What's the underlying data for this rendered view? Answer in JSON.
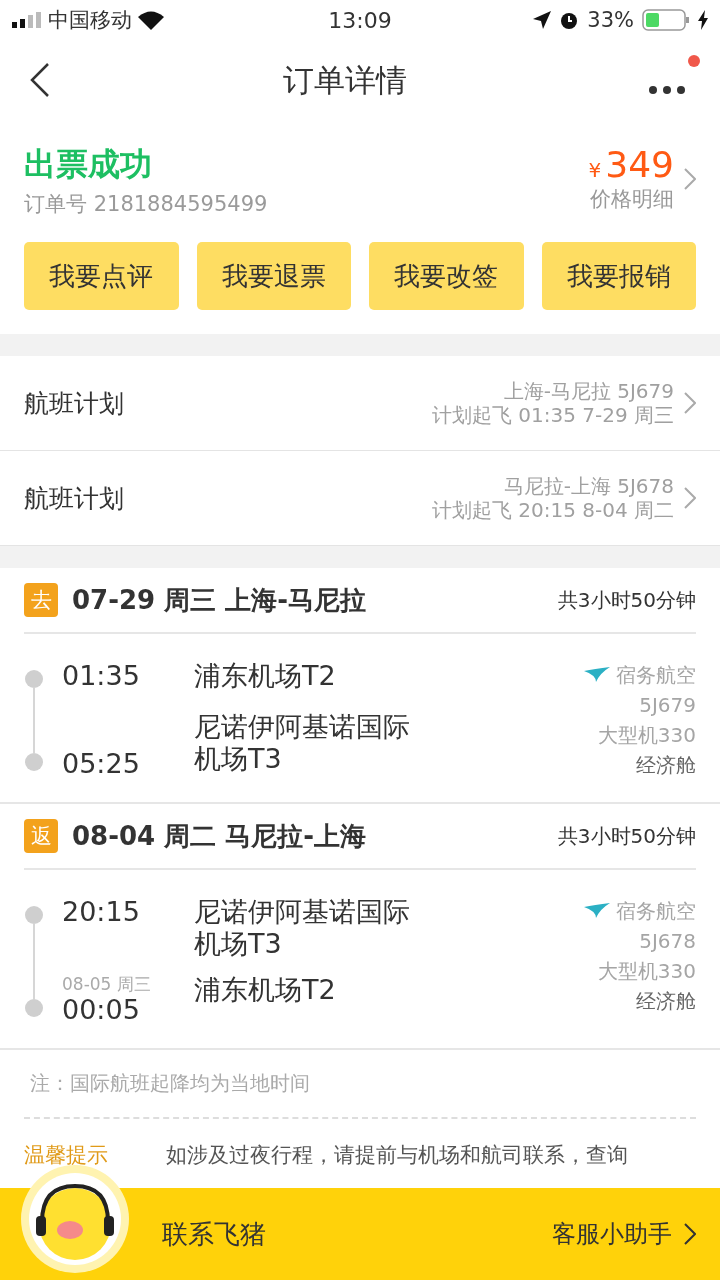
{
  "status_bar": {
    "carrier": "中国移动",
    "time": "13:09",
    "battery": "33%"
  },
  "header": {
    "title": "订单详情",
    "notification_dot": true
  },
  "order": {
    "status": "出票成功",
    "order_number": "订单号 2181884595499",
    "currency": "¥",
    "price": "349",
    "price_link": "价格明细"
  },
  "actions": [
    "我要点评",
    "我要退票",
    "我要改签",
    "我要报销"
  ],
  "flight_plans": [
    {
      "label": "航班计划",
      "route": "上海-马尼拉 5J679",
      "schedule": "计划起飞 01:35 7-29 周三"
    },
    {
      "label": "航班计划",
      "route": "马尼拉-上海 5J678",
      "schedule": "计划起飞 20:15 8-04 周二"
    }
  ],
  "trips": [
    {
      "tag": "去",
      "title": "07-29 周三 上海-马尼拉",
      "duration": "共3小时50分钟",
      "legs": [
        {
          "time": "01:35",
          "airport": "浦东机场T2"
        },
        {
          "time": "05:25",
          "airport": "尼诺伊阿基诺国际机场T3"
        }
      ],
      "airline": "宿务航空",
      "flight_no": "5J679",
      "aircraft": "大型机330",
      "cabin": "经济舱"
    },
    {
      "tag": "返",
      "title": "08-04 周二 马尼拉-上海",
      "duration": "共3小时50分钟",
      "legs": [
        {
          "time": "20:15",
          "airport": "尼诺伊阿基诺国际机场T3"
        },
        {
          "date": "08-05 周三",
          "time": "00:05",
          "airport": "浦东机场T2"
        }
      ],
      "airline": "宿务航空",
      "flight_no": "5J678",
      "aircraft": "大型机330",
      "cabin": "经济舱"
    }
  ],
  "note": "注：国际航班起降均为当地时间",
  "tip": {
    "label": "温馨提示",
    "text": "如涉及过夜行程，请提前与机场和航司联系，查询"
  },
  "bottom_bar": {
    "label": "联系飞猪",
    "link": "客服小助手"
  }
}
